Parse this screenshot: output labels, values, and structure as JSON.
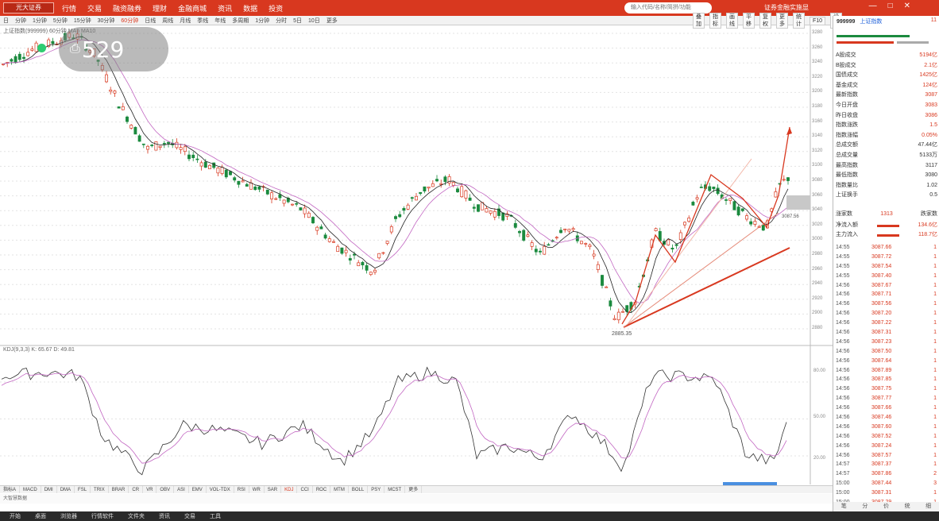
{
  "menu": {
    "brand": "光大证券",
    "items": [
      "行情",
      "交易",
      "融资融券",
      "理财",
      "金融商城",
      "资讯",
      "数据",
      "投资"
    ],
    "search_placeholder": "输入代码/名称/简拼/功能",
    "account": "证券金融实施显",
    "window_controls": [
      "—",
      "□",
      "✕"
    ]
  },
  "period_toolbar": {
    "items": [
      "日",
      "分钟",
      "1分钟",
      "5分钟",
      "15分钟",
      "30分钟",
      "60分钟",
      "日线",
      "周线",
      "月线",
      "季线",
      "年线",
      "多周期",
      "1分钟",
      "分时",
      "5日",
      "10日",
      "更多"
    ],
    "active_index": 6,
    "right_tools": [
      "叠加",
      "指标",
      "画线",
      "平移",
      "复权",
      "更多",
      "统计",
      "F10",
      "设置",
      "□"
    ]
  },
  "indicator_legend": "上证指数(999999) 60分钟 MA5 MA10",
  "screenshot_badge": {
    "count": "529"
  },
  "price_axis": [
    "3280",
    "3260",
    "3240",
    "3220",
    "3200",
    "3180",
    "3160",
    "3140",
    "3120",
    "3100",
    "3080",
    "3060",
    "3040",
    "3020",
    "3000",
    "2980",
    "2960",
    "2940",
    "2920",
    "2900",
    "2880"
  ],
  "kdj_legend": "KDJ(9,3,3) K: 65.67  D: 49.81",
  "kdj_axis": [
    "80.00",
    "50.00",
    "20.00"
  ],
  "low_annotation": "2885.35",
  "price_tag": "3087.56",
  "bottom_tabs": [
    "指标A",
    "MACD",
    "DMI",
    "DMA",
    "FSL",
    "TRIX",
    "BRAR",
    "CR",
    "VR",
    "OBV",
    "ASI",
    "EMV",
    "VOL-TDX",
    "RSI",
    "WR",
    "SAR",
    "KDJ",
    "CCI",
    "ROC",
    "MTM",
    "BOLL",
    "PSY",
    "MCST",
    "更多"
  ],
  "bottom_tabs_active": 16,
  "status_footer": "大智慧数据",
  "taskbar_items": [
    "开始",
    "桌面",
    "浏览器",
    "行情软件",
    "文件夹",
    "资讯",
    "交易",
    "工具"
  ],
  "right_panel": {
    "code": "999999",
    "name": "上证指数",
    "value": "11",
    "rows": [
      {
        "label": "A股成交",
        "value": "5194亿"
      },
      {
        "label": "B股成交",
        "value": "2.1亿"
      },
      {
        "label": "国债成交",
        "value": "1425亿"
      },
      {
        "label": "基金成交",
        "value": "124亿"
      },
      {
        "label": "最新指数",
        "value": "3087"
      },
      {
        "label": "今日开盘",
        "value": "3083"
      },
      {
        "label": "昨日收盘",
        "value": "3086"
      },
      {
        "label": "指数涨跌",
        "value": "1.5"
      },
      {
        "label": "指数涨幅",
        "value": "0.05%"
      },
      {
        "label": "总成交额",
        "value": "47.44亿"
      },
      {
        "label": "总成交量",
        "value": "5133万"
      },
      {
        "label": "最高指数",
        "value": "3117"
      },
      {
        "label": "最低指数",
        "value": "3080"
      },
      {
        "label": "指数量比",
        "value": "1.02"
      },
      {
        "label": "上证换手",
        "value": "0.5"
      }
    ],
    "flow_header": {
      "label": "涨家数",
      "value": "1313",
      "label2": "跌家数"
    },
    "flow_rows": [
      {
        "label": "净流入额",
        "value": "134.6亿"
      },
      {
        "label": "主力流入",
        "value": "118.7亿"
      }
    ],
    "ticks": [
      {
        "t": "14:55",
        "p": "3087.66",
        "v": "1"
      },
      {
        "t": "14:55",
        "p": "3087.72",
        "v": "1"
      },
      {
        "t": "14:55",
        "p": "3087.54",
        "v": "1"
      },
      {
        "t": "14:55",
        "p": "3087.40",
        "v": "1"
      },
      {
        "t": "14:56",
        "p": "3087.67",
        "v": "1"
      },
      {
        "t": "14:56",
        "p": "3087.71",
        "v": "1"
      },
      {
        "t": "14:56",
        "p": "3087.56",
        "v": "1"
      },
      {
        "t": "14:56",
        "p": "3087.20",
        "v": "1"
      },
      {
        "t": "14:56",
        "p": "3087.22",
        "v": "1"
      },
      {
        "t": "14:56",
        "p": "3087.31",
        "v": "1"
      },
      {
        "t": "14:56",
        "p": "3087.23",
        "v": "1"
      },
      {
        "t": "14:56",
        "p": "3087.50",
        "v": "1"
      },
      {
        "t": "14:56",
        "p": "3087.64",
        "v": "1"
      },
      {
        "t": "14:56",
        "p": "3087.89",
        "v": "1"
      },
      {
        "t": "14:56",
        "p": "3087.85",
        "v": "1"
      },
      {
        "t": "14:56",
        "p": "3087.75",
        "v": "1"
      },
      {
        "t": "14:56",
        "p": "3087.77",
        "v": "1"
      },
      {
        "t": "14:56",
        "p": "3087.66",
        "v": "1"
      },
      {
        "t": "14:56",
        "p": "3087.46",
        "v": "1"
      },
      {
        "t": "14:56",
        "p": "3087.60",
        "v": "1"
      },
      {
        "t": "14:56",
        "p": "3087.52",
        "v": "1"
      },
      {
        "t": "14:56",
        "p": "3087.24",
        "v": "1"
      },
      {
        "t": "14:56",
        "p": "3087.57",
        "v": "1"
      },
      {
        "t": "14:57",
        "p": "3087.37",
        "v": "1"
      },
      {
        "t": "14:57",
        "p": "3087.86",
        "v": "2"
      },
      {
        "t": "15:00",
        "p": "3087.44",
        "v": "3"
      },
      {
        "t": "15:00",
        "p": "3087.31",
        "v": "1"
      },
      {
        "t": "15:00",
        "p": "3087.29",
        "v": "1"
      }
    ],
    "footer": [
      "笔",
      "分",
      "价",
      "统",
      "细"
    ]
  }
}
